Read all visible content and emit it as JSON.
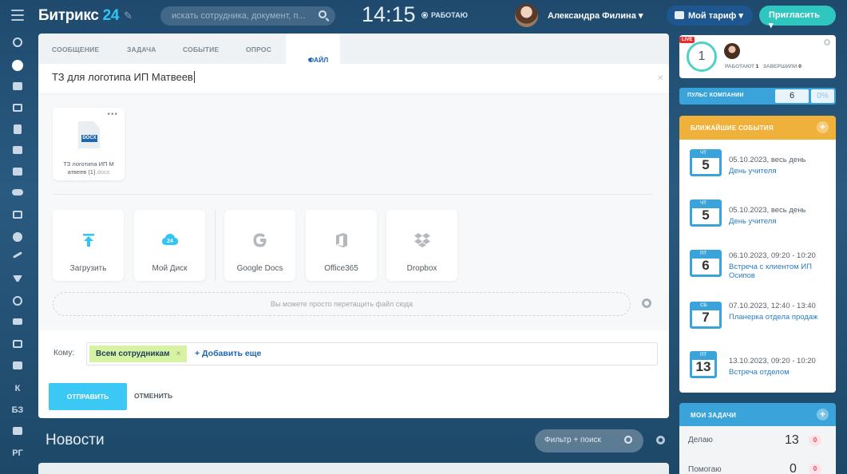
{
  "header": {
    "logo_text": "Битрикс",
    "logo_num": "24",
    "search_placeholder": "искать сотрудника, документ, п...",
    "clock": "14:15",
    "work_status": "РАБОТАЮ",
    "user_name": "Александра Филина",
    "tariff_label": "Мой тариф",
    "invite_label": "Пригласить"
  },
  "sidebar": {
    "items": [
      "stream",
      "tasks",
      "chat",
      "calendar",
      "docs",
      "drive",
      "mail",
      "groups",
      "time",
      "crm",
      "sales",
      "funnel",
      "analytics",
      "shop",
      "sites",
      "robots",
      "К",
      "БЗ",
      "rpa",
      "РГ"
    ]
  },
  "composer": {
    "tabs": [
      "СООБЩЕНИЕ",
      "ЗАДАЧА",
      "СОБЫТИЕ",
      "ОПРОС"
    ],
    "active_tab": "ФАЙЛ",
    "title": "ТЗ для логотипа ИП Матвеев",
    "file": {
      "name": "ТЗ логотипа ИП М атвеев (1)",
      "ext": ".docx",
      "icon_label": "DOCX"
    },
    "sources": [
      "Загрузить",
      "Мой Диск",
      "Google Docs",
      "Office365",
      "Dropbox"
    ],
    "dropzone_text": "Вы можете просто перетащить файл сюда",
    "to_label": "Кому:",
    "recipient": "Всем сотрудникам",
    "add_more": "+ Добавить еще",
    "send_label": "ОТПРАВИТЬ",
    "cancel_label": "ОТМЕНИТЬ"
  },
  "news": {
    "title": "Новости",
    "filter_placeholder": "Фильтр + поиск"
  },
  "right": {
    "live": {
      "badge": "LIVE",
      "count": "1",
      "working_label": "РАБОТАЮТ",
      "working": "1",
      "done_label": "ЗАВЕРШИЛИ",
      "done": "0"
    },
    "pulse": {
      "label": "ПУЛЬС КОМПАНИИ",
      "value": "6",
      "percent": "0%"
    },
    "events_title": "БЛИЖАЙШИЕ СОБЫТИЯ",
    "events": [
      {
        "dow": "ЧТ",
        "day": "5",
        "time": "05.10.2023, весь день",
        "title": "День учителя"
      },
      {
        "dow": "ЧТ",
        "day": "5",
        "time": "05.10.2023, весь день",
        "title": "День учителя"
      },
      {
        "dow": "ПТ",
        "day": "6",
        "time": "06.10.2023, 09:20 - 10:20",
        "title": "Встреча с клиентом ИП Осипов"
      },
      {
        "dow": "СБ",
        "day": "7",
        "time": "07.10.2023, 12:40 - 13:40",
        "title": "Планерка отдела продаж"
      },
      {
        "dow": "ПТ",
        "day": "13",
        "time": "13.10.2023, 09:20 - 10:20",
        "title": "Встреча отделом"
      }
    ],
    "tasks_title": "МОИ ЗАДАЧИ",
    "tasks": [
      {
        "label": "Делаю",
        "count": "13",
        "badge": "0"
      },
      {
        "label": "Помогаю",
        "count": "0",
        "badge": "0"
      }
    ]
  },
  "colors": {
    "accent": "#3bc8f5",
    "link": "#2066b0",
    "events": "#f0b13a",
    "pulse": "#3aa3d9"
  }
}
